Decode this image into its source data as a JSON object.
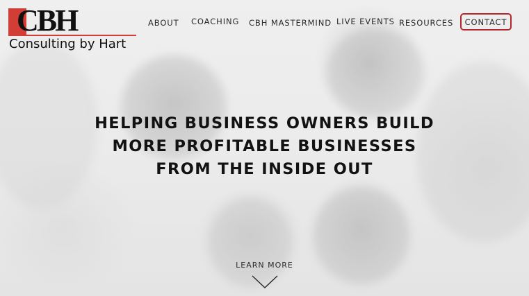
{
  "logo": {
    "letters": "CBH",
    "tagline": "Consulting by Hart"
  },
  "nav": {
    "about": "ABOUT",
    "coaching": "COACHING",
    "mastermind": "CBH MASTERMIND",
    "live_events": "LIVE EVENTS",
    "resources": "RESOURCES",
    "contact": "CONTACT"
  },
  "hero": {
    "headline": [
      "HELPING BUSINESS OWNERS BUILD",
      "MORE PROFITABLE BUSINESSES",
      "FROM THE INSIDE OUT"
    ],
    "cta": "LEARN MORE"
  },
  "icons": {
    "scroll": "chevron-down-icon"
  },
  "colors": {
    "brand_red": "#d23e36",
    "contact_border": "#b3262c",
    "text_dark": "#121212"
  }
}
